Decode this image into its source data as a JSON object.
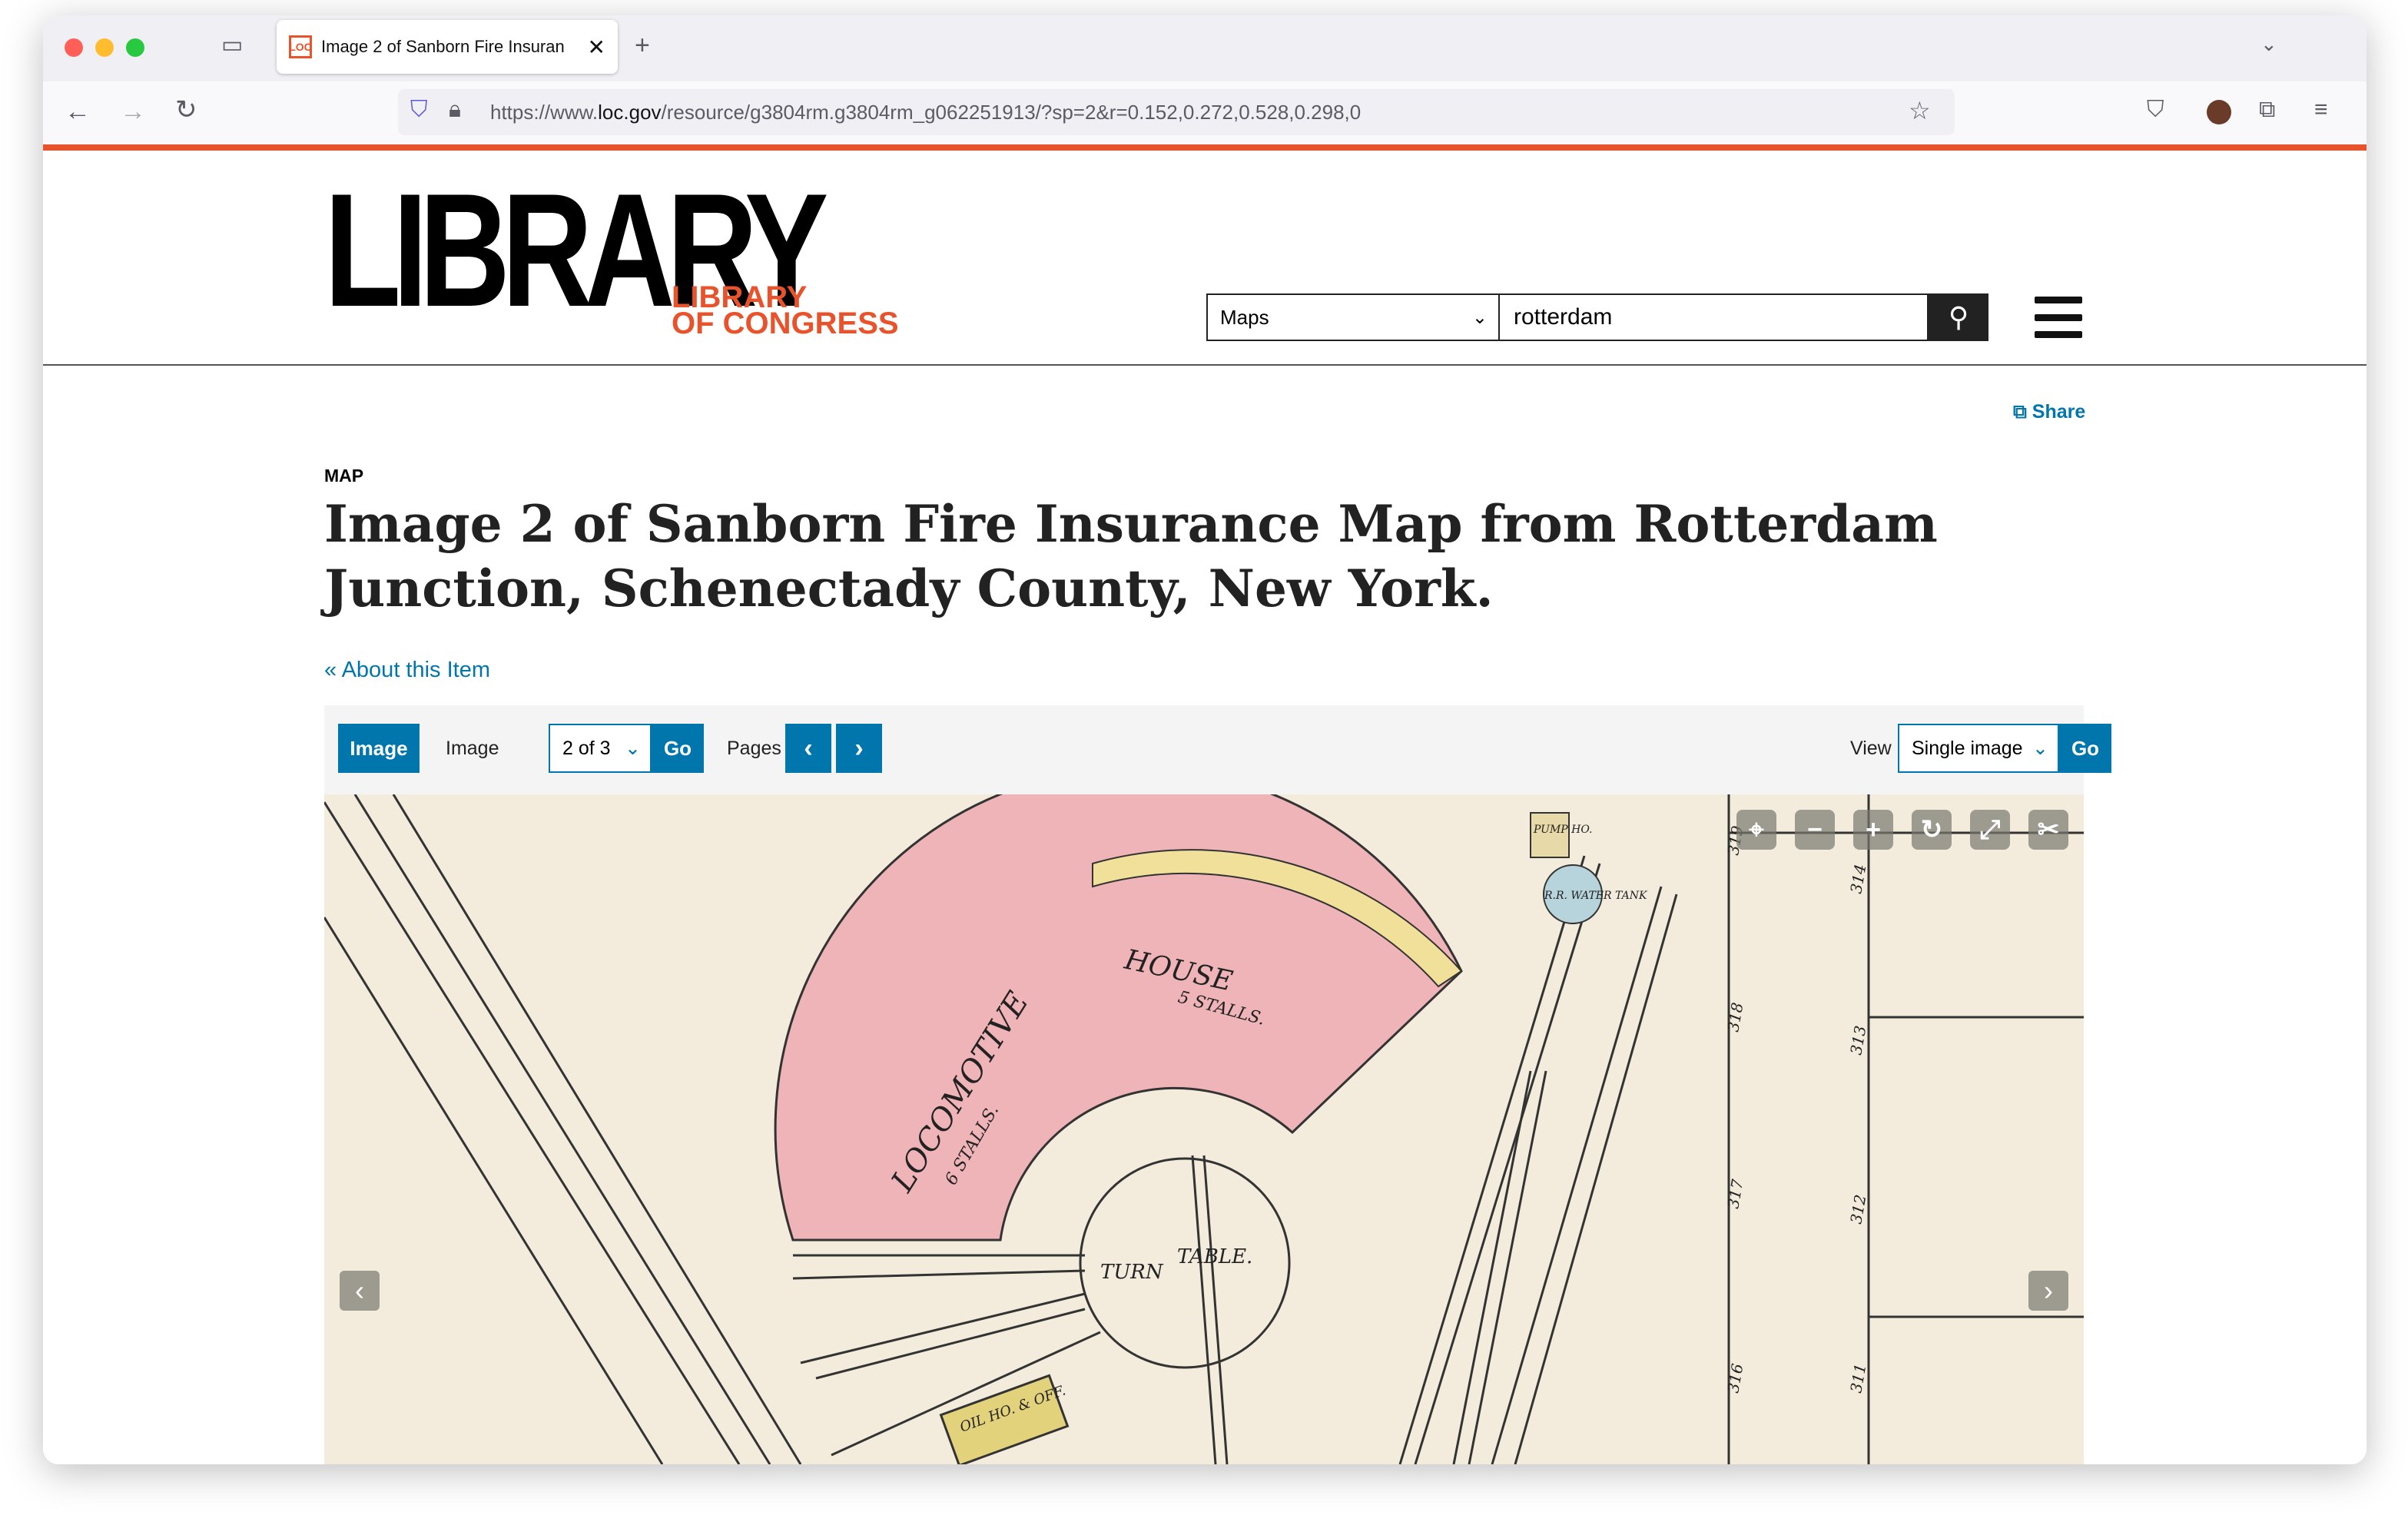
{
  "browser": {
    "tab_title": "Image 2 of Sanborn Fire Insuran",
    "favicon_text": "LOC",
    "url_prefix": "https://www.",
    "url_domain": "loc.gov",
    "url_path": "/resource/g3804rm.g3804rm_g062251913/?sp=2&r=0.152,0.272,0.528,0.298,0"
  },
  "header": {
    "logo_main": "LIBRARY",
    "logo_sub1": "LIBRARY",
    "logo_sub2": "OF CONGRESS",
    "search_scope": "Maps",
    "search_value": "rotterdam"
  },
  "page": {
    "share": "Share",
    "kind": "MAP",
    "title": "Image 2 of Sanborn Fire Insurance Map from Rotterdam Junction, Schenectady County, New York.",
    "about_link": "« About this Item"
  },
  "toolbar": {
    "image_button": "Image",
    "image_label": "Image",
    "image_select": "2 of 3",
    "go": "Go",
    "pages_label": "Pages",
    "view_label": "View",
    "view_select": "Single image"
  },
  "map_labels": {
    "locomotive": "LOCOMOTIVE",
    "house": "HOUSE",
    "stalls6": "6 STALLS.",
    "stalls5": "5 STALLS.",
    "turn": "TURN",
    "table": "TABLE.",
    "pump": "PUMP HO.",
    "tank": "R.R. WATER TANK",
    "oil": "OIL HO. & OFF.",
    "n319": "319",
    "n318": "318",
    "n317": "317",
    "n316": "316",
    "n314": "314",
    "n313": "313",
    "n312": "312",
    "n311": "311"
  },
  "colors": {
    "accent": "#0076ad",
    "brand": "#e9532b",
    "map_pink": "#efb4b8"
  }
}
